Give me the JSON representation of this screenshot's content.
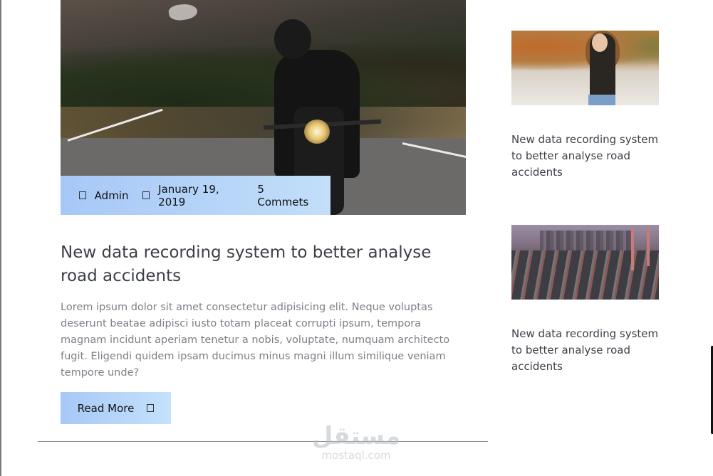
{
  "main_post": {
    "meta": {
      "author": "Admin",
      "date": "January 19, 2019",
      "comments": "5 Commets"
    },
    "title": "New data recording system to better analyse road accidents",
    "excerpt": "Lorem ipsum dolor sit amet consectetur adipisicing elit. Neque voluptas deserunt beatae adipisci iusto totam placeat corrupti ipsum, tempora magnam incidunt aperiam tenetur a nobis, voluptate, numquam architecto fugit. Eligendi quidem ipsam ducimus minus magni illum similique veniam tempore unde?",
    "read_more_label": "Read More"
  },
  "sidebar": {
    "posts": [
      {
        "title": "New data recording system to better analyse road accidents"
      },
      {
        "title": "New data recording system to better analyse road accidents"
      }
    ]
  },
  "watermark": {
    "arabic": "مستقل",
    "latin": "mostaql.com"
  },
  "colors": {
    "accent_gradient_start": "#a7c8f7",
    "accent_gradient_end": "#c4e2fb",
    "title_text": "#3b3f46",
    "body_text": "#7b7f86"
  },
  "icons": {
    "author": "user-icon",
    "date": "calendar-icon",
    "read_more": "arrow-right-icon"
  }
}
